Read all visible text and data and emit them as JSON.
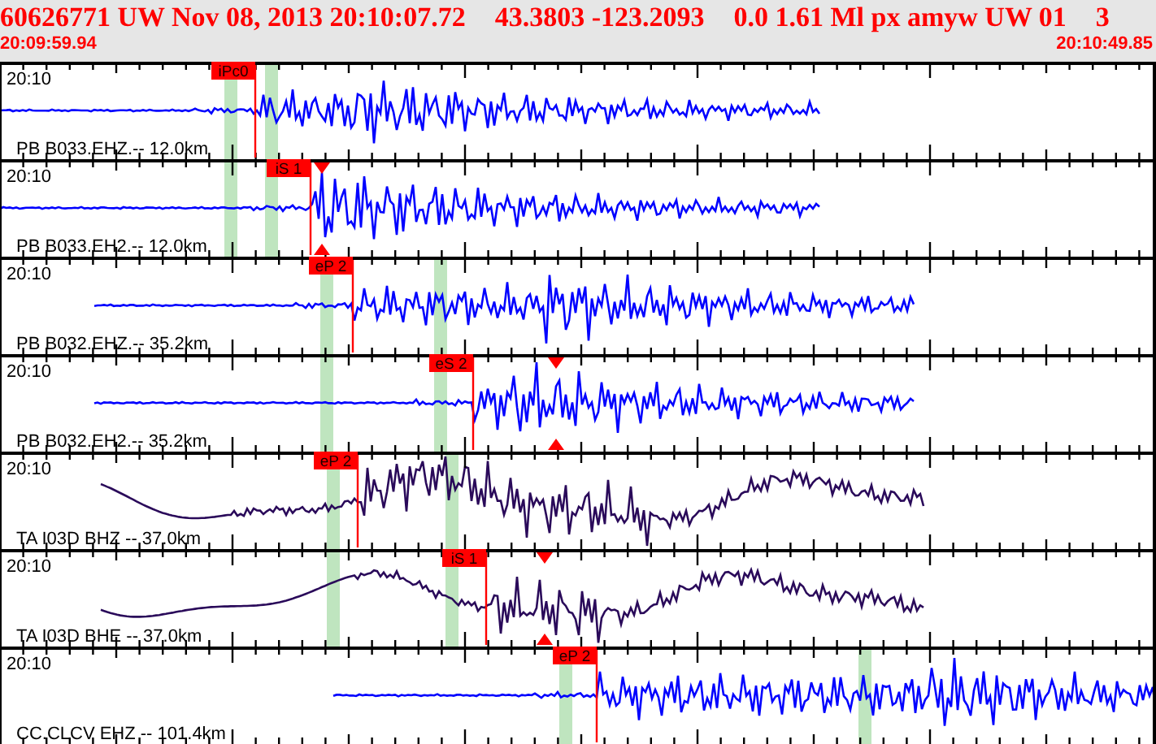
{
  "header": {
    "title_parts": [
      "60626771 UW Nov 08, 2013 20:10:07.72",
      "43.3803 -123.2093",
      "0.0 1.61 Ml px amyw UW 01",
      "3"
    ],
    "start_time": "20:09:59.94",
    "end_time": "20:10:49.85"
  },
  "traces": [
    {
      "time_label": "20:10",
      "station": "PB B033.EHZ.-- 12.0km",
      "color": "#0000ff",
      "pick": "iPc0",
      "amplitude_marker": false
    },
    {
      "time_label": "20:10",
      "station": "PB B033.EH2.-- 12.0km",
      "color": "#0000ff",
      "pick": "iS 1",
      "amplitude_marker": true
    },
    {
      "time_label": "20:10",
      "station": "PB B032.EHZ.-- 35.2km",
      "color": "#0000ff",
      "pick": "eP 2",
      "amplitude_marker": false
    },
    {
      "time_label": "20:10",
      "station": "PB B032.EH2.-- 35.2km",
      "color": "#0000ff",
      "pick": "eS 2",
      "amplitude_marker": true
    },
    {
      "time_label": "20:10",
      "station": "TA I03D BHZ -- 37.0km",
      "color": "#2a0a5a",
      "pick": "eP 2",
      "amplitude_marker": false
    },
    {
      "time_label": "20:10",
      "station": "TA I03D BHE -- 37.0km",
      "color": "#2a0a5a",
      "pick": "iS 1",
      "amplitude_marker": true
    },
    {
      "time_label": "20:10",
      "station": "CC.CLCV EHZ -- 101.4km",
      "color": "#0000ff",
      "pick": "eP 2",
      "amplitude_marker": false
    }
  ]
}
